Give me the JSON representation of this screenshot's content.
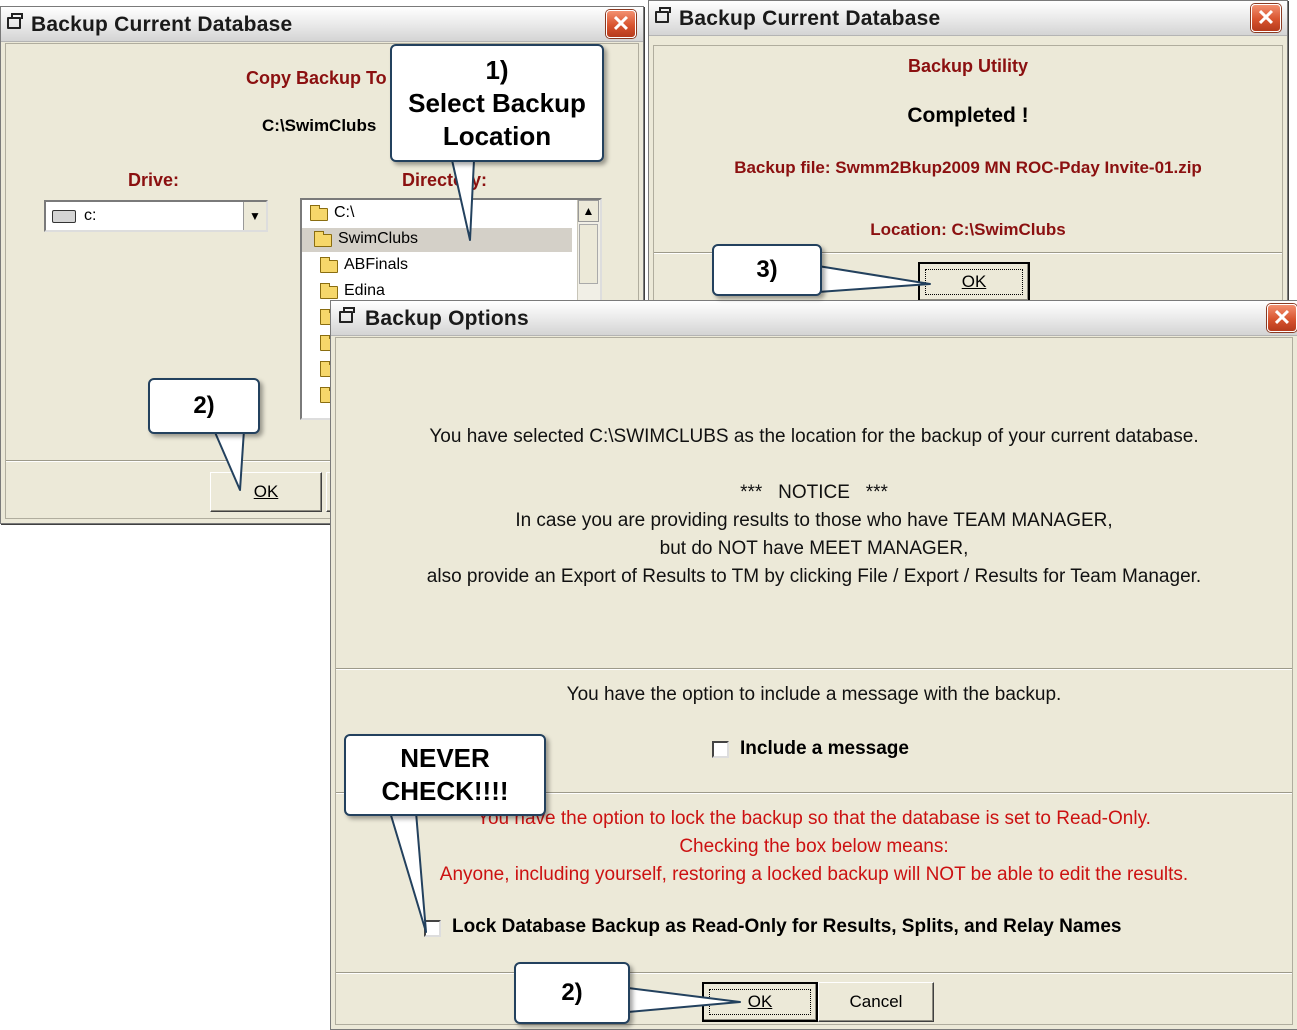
{
  "win1": {
    "title": "Backup Current Database",
    "close": "✕",
    "heading": "Copy Backup To",
    "path": "C:\\SwimClubs",
    "drive_label": "Drive:",
    "drive_value": "c:",
    "directory_label": "Directory:",
    "dir_items": [
      "C:\\",
      "SwimClubs",
      "ABFinals",
      "Edina"
    ],
    "ok_label": "OK"
  },
  "win2": {
    "title": "Backup Current Database",
    "close": "✕",
    "heading": "Backup Utility",
    "completed": "Completed !",
    "file_line": "Backup file: Swmm2Bkup2009 MN ROC-Pday Invite-01.zip",
    "location_line": "Location: C:\\SwimClubs",
    "ok_label": "OK"
  },
  "win3": {
    "title": "Backup Options",
    "close": "✕",
    "selected_msg": "You have selected C:\\SWIMCLUBS as the location for the backup of your current database.",
    "notice": "***   NOTICE   ***",
    "notice_l1": "In case you are providing results to those who have TEAM MANAGER,",
    "notice_l2": "but do NOT have MEET MANAGER,",
    "notice_l3": "also provide an Export of Results to TM by clicking File / Export / Results for Team Manager.",
    "message_option": "You have the option to include a message with the backup.",
    "include_message_label": "Include a message",
    "include_message_checked": false,
    "lock_l1": "You have the option to lock the backup so that the database is set to Read-Only.",
    "lock_l2": "Checking the box below means:",
    "lock_l3": "Anyone, including yourself, restoring a locked backup will NOT be able to edit the results.",
    "lock_label": "Lock Database Backup as Read-Only for Results, Splits, and Relay Names",
    "lock_checked": false,
    "ok_label": "OK",
    "cancel_label": "Cancel"
  },
  "callouts": {
    "c1_l1": "1)",
    "c1_l2": "Select Backup",
    "c1_l3": "Location",
    "c2a": "2)",
    "c3": "3)",
    "never_l1": "NEVER",
    "never_l2": "CHECK!!!!",
    "c2b": "2)"
  },
  "colors": {
    "dialog_bg": "#ece9d8",
    "dark_red": "#8b1010",
    "red": "#cc1111",
    "callout_border": "#23415e",
    "close_button": "#d8542f"
  },
  "icons": [
    "window-icon",
    "close-icon",
    "drive-icon",
    "folder-icon",
    "dropdown-arrow-icon",
    "scroll-up-icon"
  ]
}
